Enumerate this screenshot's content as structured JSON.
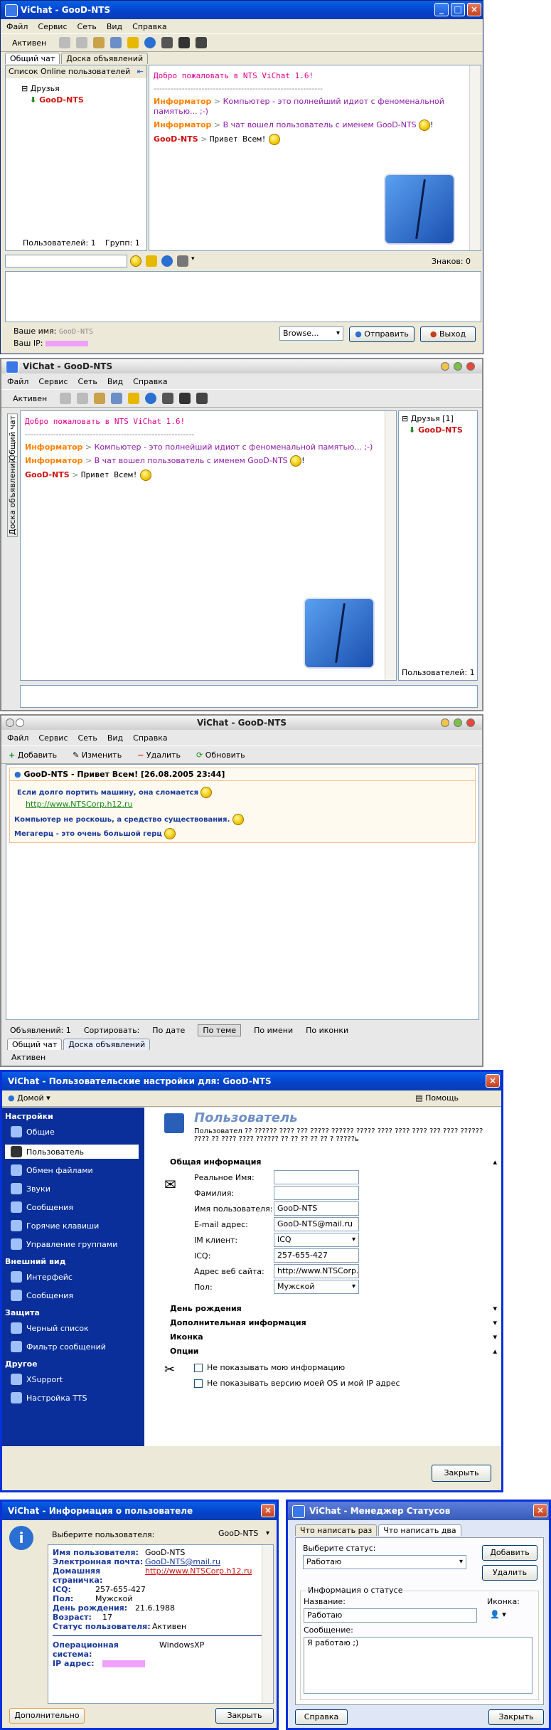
{
  "screens": {
    "chat_xp": {
      "title": "ViChat - GooD-NTS",
      "menu": [
        "Файл",
        "Сервис",
        "Сеть",
        "Вид",
        "Справка"
      ],
      "status_button": "Активен",
      "tabs": [
        "Общий чат",
        "Доска объявлений"
      ],
      "userlist_title": "Список Online пользователей",
      "group": "Друзья",
      "user": "GooD-NTS",
      "users_count": "Пользователей: 1",
      "groups_count": "Групп: 1",
      "messages": [
        {
          "text": "Добро пожаловать в NTS ViChat 1.6!"
        },
        {
          "sender": "Информатор",
          "sep": ">",
          "text": "Компьютер - это полнейший идиот с феноменальной памятью... ;-)"
        },
        {
          "sender": "Информатор",
          "sep": ">",
          "text": "В чат вошел пользователь с именем GooD-NTS"
        },
        {
          "sender": "GooD-NTS",
          "sep": ">",
          "text": "Привет Всем!"
        }
      ],
      "divider": "------------------------------------------------------------",
      "chars_label": "Знаков: 0",
      "your_name_label": "Ваше имя:",
      "your_name": "GooD-NTS",
      "your_ip_label": "Ваш IP:",
      "browse": "Browse...",
      "send": "Отправить",
      "exit": "Выход"
    },
    "chat_mac": {
      "title": "ViChat - GooD-NTS",
      "menu": [
        "Файл",
        "Сервис",
        "Сеть",
        "Вид",
        "Справка"
      ],
      "status_button": "Активен",
      "vtabs": [
        "Общий чат",
        "Доска объявлений"
      ],
      "group": "Друзья [1]",
      "user": "GooD-NTS",
      "users_count": "Пользователей: 1",
      "messages": [
        {
          "text": "Добро пожаловать в NTS ViChat 1.6!"
        },
        {
          "sender": "Информатор",
          "sep": ">",
          "text": "Компьютер - это полнейший идиот с феноменальной памятью... ;-)"
        },
        {
          "sender": "Информатор",
          "sep": ">",
          "text": "В чат вошел пользователь с именем GooD-NTS"
        },
        {
          "sender": "GooD-NTS",
          "sep": ">",
          "text": "Привет Всем!"
        }
      ],
      "divider": "------------------------------------------------------------"
    },
    "board": {
      "title": "ViChat - GooD-NTS",
      "menu": [
        "Файл",
        "Сервис",
        "Сеть",
        "Вид",
        "Справка"
      ],
      "tool_add": "Добавить",
      "tool_edit": "Изменить",
      "tool_delete": "Удалить",
      "tool_refresh": "Обновить",
      "post_title": "GooD-NTS - Привет Всем! [26.08.2005 23:44]",
      "lines": [
        "Если долго портить машину, она сломается",
        "http://www.NTSCorp.h12.ru",
        "Компьютер не роскошь, а средство существования.",
        "Мегагерц - это очень большой герц"
      ],
      "ads_count": "Объявлений: 1",
      "sort_label": "Сортировать:",
      "sort_options": [
        "По дате",
        "По теме",
        "По имени",
        "По иконки"
      ],
      "tabs": [
        "Общий чат",
        "Доска объявлений"
      ],
      "status_button": "Активен"
    },
    "settings": {
      "title": "ViChat - Пользовательские настройки для: GooD-NTS",
      "home": "Домой",
      "help": "Помощь",
      "side_head1": "Настройки",
      "side1": [
        "Общие",
        "Пользователь",
        "Обмен файлами",
        "Звуки",
        "Сообщения",
        "Горячие клавиши",
        "Управление группами"
      ],
      "side_head2": "Внешний вид",
      "side2": [
        "Интерфейс",
        "Сообщения"
      ],
      "side_head3": "Защита",
      "side3": [
        "Черный список",
        "Фильтр сообщений"
      ],
      "side_head4": "Другое",
      "side4": [
        "XSupport",
        "Настройка TTS"
      ],
      "page_title": "Пользователь",
      "page_desc": "Пользовател ?? ?????? ???? ??? ????? ?????? ????? ???? ???? ???? ??? ???? ?????? ???? ?? ???? ???? ?????? ?? ?? ?? ?? ?? ? ?????ь",
      "sec_general": "Общая информация",
      "labels": [
        "Реальное Имя:",
        "Фамилия:",
        "Имя пользователя:",
        "E-mail адрес:",
        "IM клиент:",
        "ICQ:",
        "Адрес веб сайта:",
        "Пол:"
      ],
      "values": [
        "",
        "",
        "GooD-NTS",
        "GooD-NTS@mail.ru",
        "ICQ",
        "257-655-427",
        "http://www.NTSCorp.h",
        "Мужской"
      ],
      "sec_birthday": "День рождения",
      "sec_extra": "Дополнительная информация",
      "sec_icon": "Иконка",
      "sec_options": "Опции",
      "opt1": "Не показывать мою информацию",
      "opt2": "Не показывать версию моей OS и мой IP адрес",
      "close": "Закрыть"
    },
    "userinfo": {
      "title": "ViChat - Информация о пользователе",
      "select_label": "Выберите пользователя:",
      "select_value": "GooD-NTS",
      "rows": [
        {
          "k": "Имя пользователя:",
          "v": "GooD-NTS"
        },
        {
          "k": "Электронная почта:",
          "v": "GooD-NTS@mail.ru"
        },
        {
          "k": "Домашняя страничка:",
          "v": "http://www.NTSCorp.h12.ru"
        },
        {
          "k": "ICQ:",
          "v": "257-655-427"
        },
        {
          "k": "Пол:",
          "v": "Мужской"
        },
        {
          "k": "День рождения:",
          "v": "21.6.1988"
        },
        {
          "k": "Возраст:",
          "v": "17"
        },
        {
          "k": "Статус пользователя:",
          "v": "Активен"
        },
        {
          "k": "Операционная система:",
          "v": "WindowsXP"
        },
        {
          "k": "IP адрес:",
          "v": ""
        }
      ],
      "more": "Дополнительно",
      "close": "Закрыть"
    },
    "status_mgr": {
      "title": "ViChat - Менеджер Статусов",
      "tabs": [
        "Что написать раз",
        "Что написать два"
      ],
      "choose_label": "Выберите статус:",
      "choose_value": "Работаю",
      "add": "Добавить",
      "delete": "Удалить",
      "group_label": "Информация о статусе",
      "name_label": "Название:",
      "icon_label": "Иконка:",
      "name_value": "Работаю",
      "msg_label": "Сообщение:",
      "msg_value": "Я работаю ;)",
      "help": "Справка",
      "close": "Закрыть"
    }
  },
  "colors": {
    "xp_title": "#0a5fe8",
    "nick": "#d01010",
    "informer": "#ff8000",
    "welcome": "#e0008a",
    "sidebar": "#0a2f9a"
  }
}
